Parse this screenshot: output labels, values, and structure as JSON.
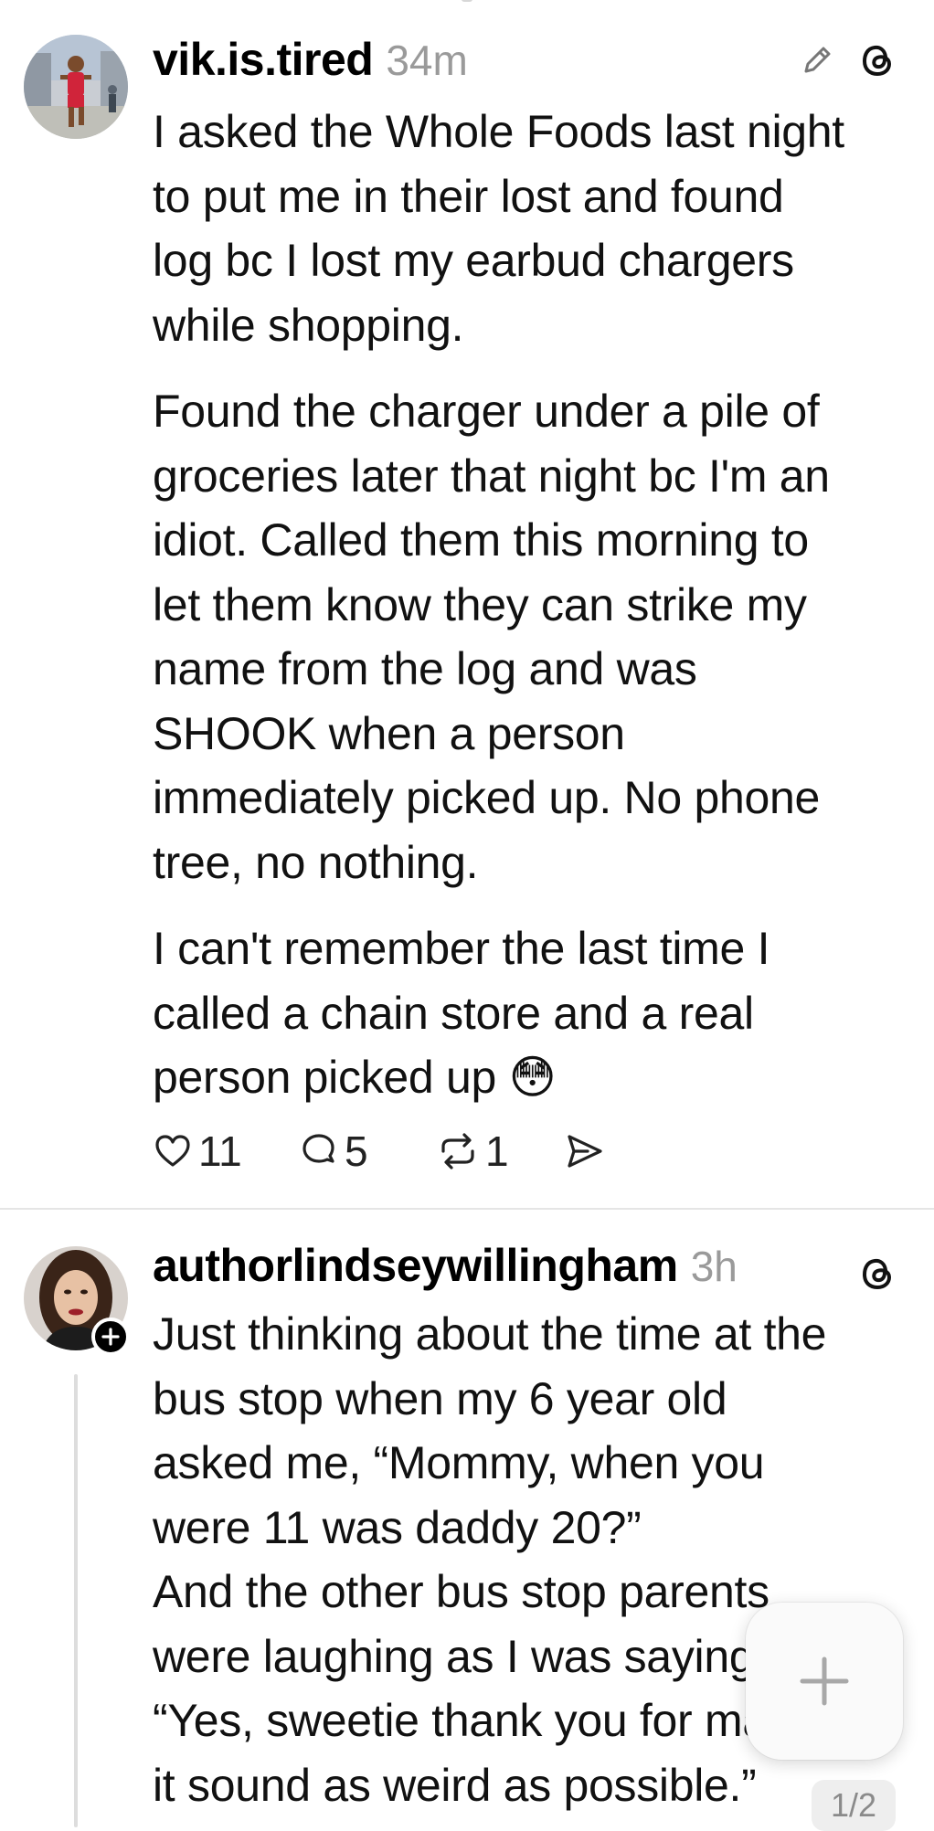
{
  "post1": {
    "username": "vik.is.tired",
    "time": "34m",
    "avatar_icon": "runner-photo-avatar",
    "paragraphs": [
      [
        "I asked the Whole Foods last night",
        "to put me in their lost and found",
        "log bc I lost my earbud chargers",
        "while shopping."
      ],
      [
        "Found the charger under a pile of",
        "groceries later that night bc I'm an",
        "idiot. Called them this morning to",
        "let them know they can strike my",
        "name from the log and was",
        "SHOOK when a person",
        "immediately picked up. No phone",
        "tree, no nothing."
      ],
      [
        "I can't remember the last time I",
        "called a chain store and a real",
        "person picked up 😳"
      ]
    ],
    "likes": "11",
    "replies": "5",
    "reposts": "1",
    "icons": {
      "edit": "pencil-icon",
      "threads": "threads-logo-icon",
      "like": "heart-icon",
      "reply": "comment-icon",
      "repost": "repost-icon",
      "share": "send-icon"
    }
  },
  "post2": {
    "username": "authorlindseywillingham",
    "time": "3h",
    "avatar_icon": "woman-photo-avatar",
    "lines": [
      "Just thinking about the time at the",
      "bus stop when my 6 year old",
      "asked me, “Mommy, when you",
      "were 11 was daddy 20?”",
      "And the other bus stop parents",
      "were laughing as I was saying",
      "“Yes, sweetie thank you for making",
      "it sound as weird as possible.”"
    ],
    "page_indicator": "1/2"
  },
  "fab": {
    "icon": "plus-icon"
  },
  "colors": {
    "text": "#000000",
    "muted": "#9a9a9a",
    "divider": "#e5e5e5",
    "background": "#ffffff"
  }
}
